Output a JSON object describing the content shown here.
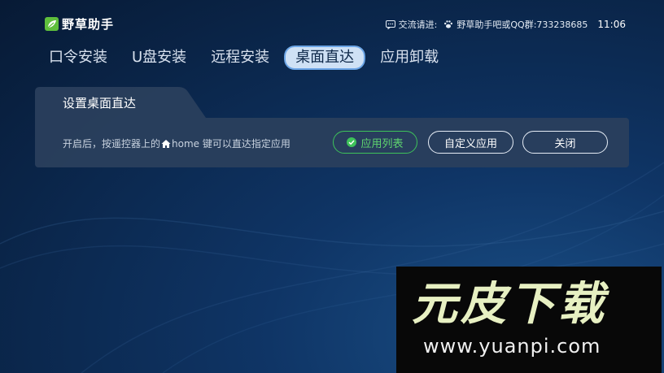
{
  "header": {
    "app_name": "野草助手",
    "contact_prefix": "交流请进:",
    "contact_info": "野草助手吧或QQ群:733238685",
    "time": "11:06"
  },
  "tabs": [
    {
      "label": "口令安装",
      "active": false
    },
    {
      "label": "U盘安装",
      "active": false
    },
    {
      "label": "远程安装",
      "active": false
    },
    {
      "label": "桌面直达",
      "active": true
    },
    {
      "label": "应用卸载",
      "active": false
    }
  ],
  "panel": {
    "title": "设置桌面直达",
    "desc_before": "开启后，按遥控器上的",
    "desc_after": "home 键可以直达指定应用",
    "buttons": {
      "app_list": "应用列表",
      "custom_app": "自定义应用",
      "close": "关闭"
    }
  },
  "watermark": {
    "brand": "元皮下载",
    "url": "www.yuanpi.com"
  },
  "colors": {
    "accent_green": "#3ec25a",
    "active_tab_bg": "#cfe1f5",
    "panel_bg": "#2a3f5d"
  }
}
